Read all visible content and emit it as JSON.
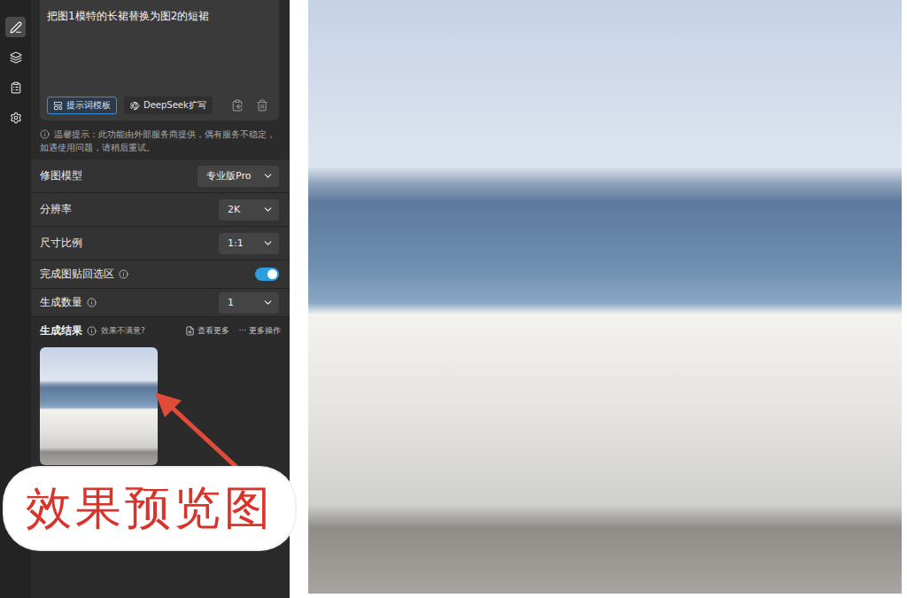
{
  "sidebar": {
    "items": [
      {
        "selected": true
      },
      {
        "selected": false
      },
      {
        "selected": false
      },
      {
        "selected": false
      }
    ]
  },
  "prompt": {
    "text": "把图1模特的长裙替换为图2的短裙",
    "buttons": [
      {
        "label": "提示词模板",
        "selected": true
      },
      {
        "label": "DeepSeek扩写",
        "selected": false
      }
    ]
  },
  "notice": "温馨提示：此功能由外部服务商提供，偶有服务不稳定，如遇使用问题，请稍后重试。",
  "settings": [
    {
      "label": "修图模型",
      "kind": "select",
      "value": "专业版Pro",
      "info": false
    },
    {
      "label": "分辨率",
      "kind": "select",
      "value": "2K",
      "info": false
    },
    {
      "label": "尺寸比例",
      "kind": "select",
      "value": "1:1",
      "info": false
    },
    {
      "label": "完成图贴回选区",
      "kind": "toggle",
      "on": true,
      "info": true
    },
    {
      "label": "生成数量",
      "kind": "select",
      "value": "1",
      "info": true
    }
  ],
  "results": {
    "title": "生成结果",
    "feedback": "效果不满意?",
    "view_more": "查看更多",
    "more_icon": "···",
    "more_actions": "更多操作"
  },
  "annotation": {
    "label": "效果预览图"
  }
}
